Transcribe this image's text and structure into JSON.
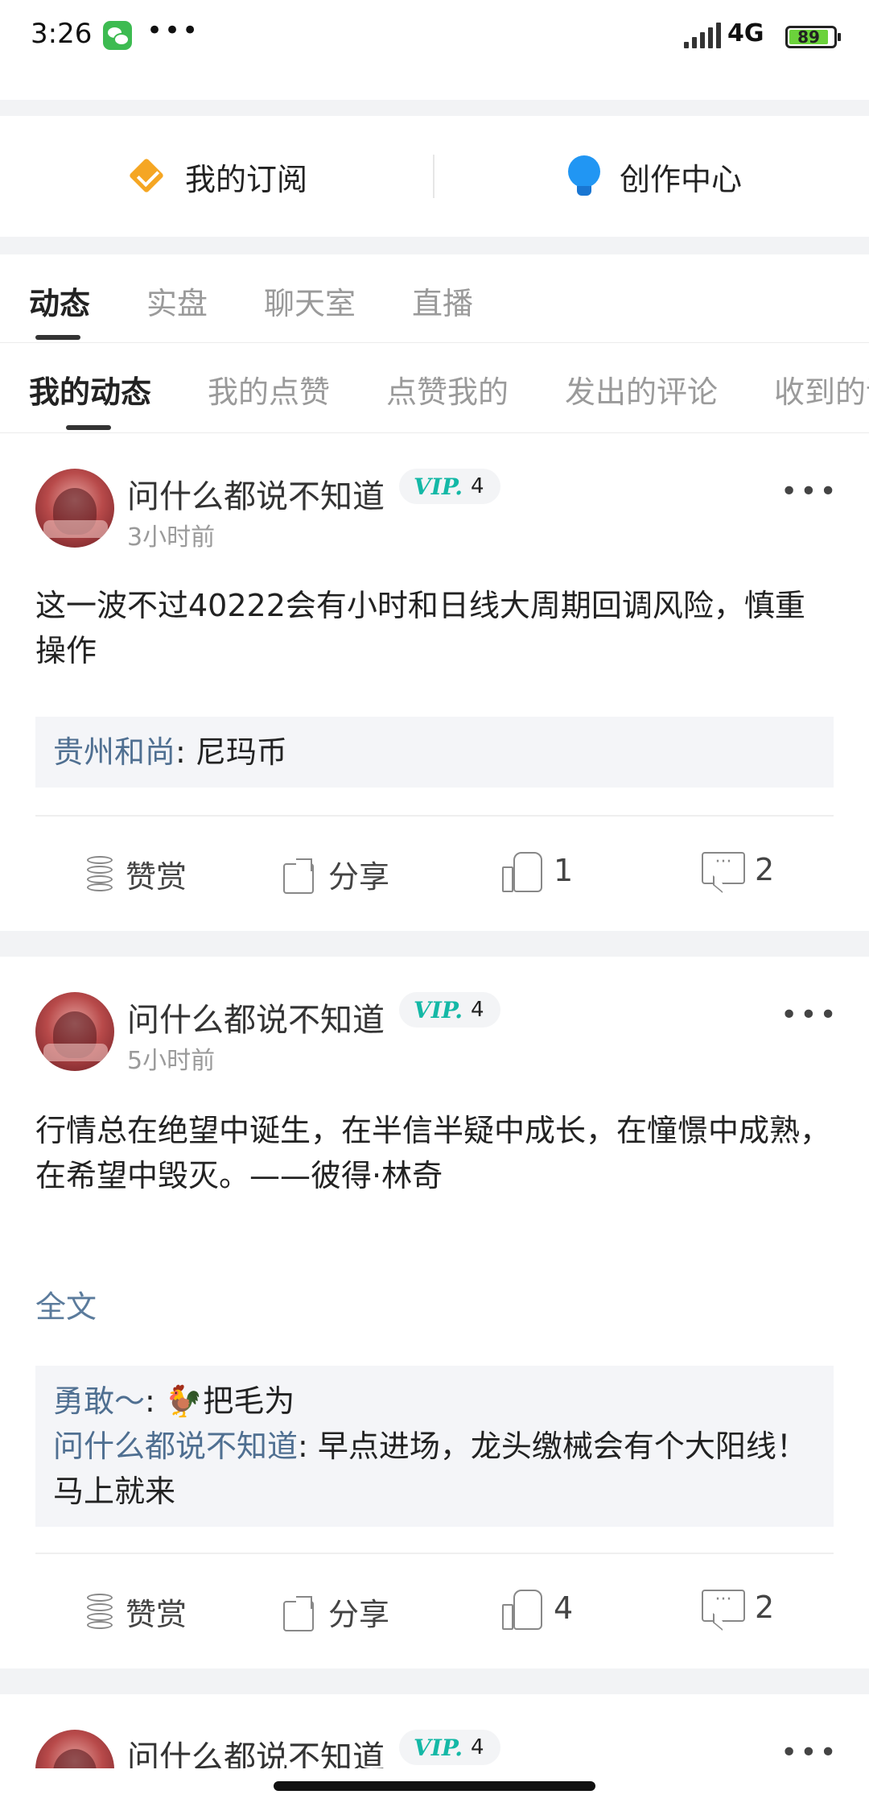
{
  "status_bar": {
    "time": "3:26",
    "more": "•••",
    "network": "4G",
    "battery": "89"
  },
  "quick_links": {
    "subscribe": "我的订阅",
    "creator": "创作中心"
  },
  "primary_tabs": [
    "动态",
    "实盘",
    "聊天室",
    "直播"
  ],
  "secondary_tabs": [
    "我的动态",
    "我的点赞",
    "点赞我的",
    "发出的评论",
    "收到的评"
  ],
  "posts": [
    {
      "username": "问什么都说不知道",
      "vip_badge": "VIP.",
      "vip_level": "4",
      "time": "3小时前",
      "content": "这一波不过40222会有小时和日线大周期回调风险，慎重操作",
      "comments": [
        {
          "author": "贵州和尚",
          "sep": ": ",
          "text": "尼玛币"
        }
      ],
      "actions": {
        "reward": "赞赏",
        "share": "分享",
        "likes": "1",
        "comments": "2"
      }
    },
    {
      "username": "问什么都说不知道",
      "vip_badge": "VIP.",
      "vip_level": "4",
      "time": "5小时前",
      "content": "行情总在绝望中诞生，在半信半疑中成长，在憧憬中成熟，在希望中毁灭。——彼得·林奇",
      "full_text": "全文",
      "comments": [
        {
          "author": "勇敢～",
          "sep": ": ",
          "text": "🐓把毛为"
        },
        {
          "author": "问什么都说不知道",
          "sep": ": ",
          "text": "早点进场，龙头缴械会有个大阳线！马上就来"
        }
      ],
      "actions": {
        "reward": "赞赏",
        "share": "分享",
        "likes": "4",
        "comments": "2"
      }
    },
    {
      "username": "问什么都说不知道",
      "vip_badge": "VIP.",
      "vip_level": "4"
    }
  ]
}
